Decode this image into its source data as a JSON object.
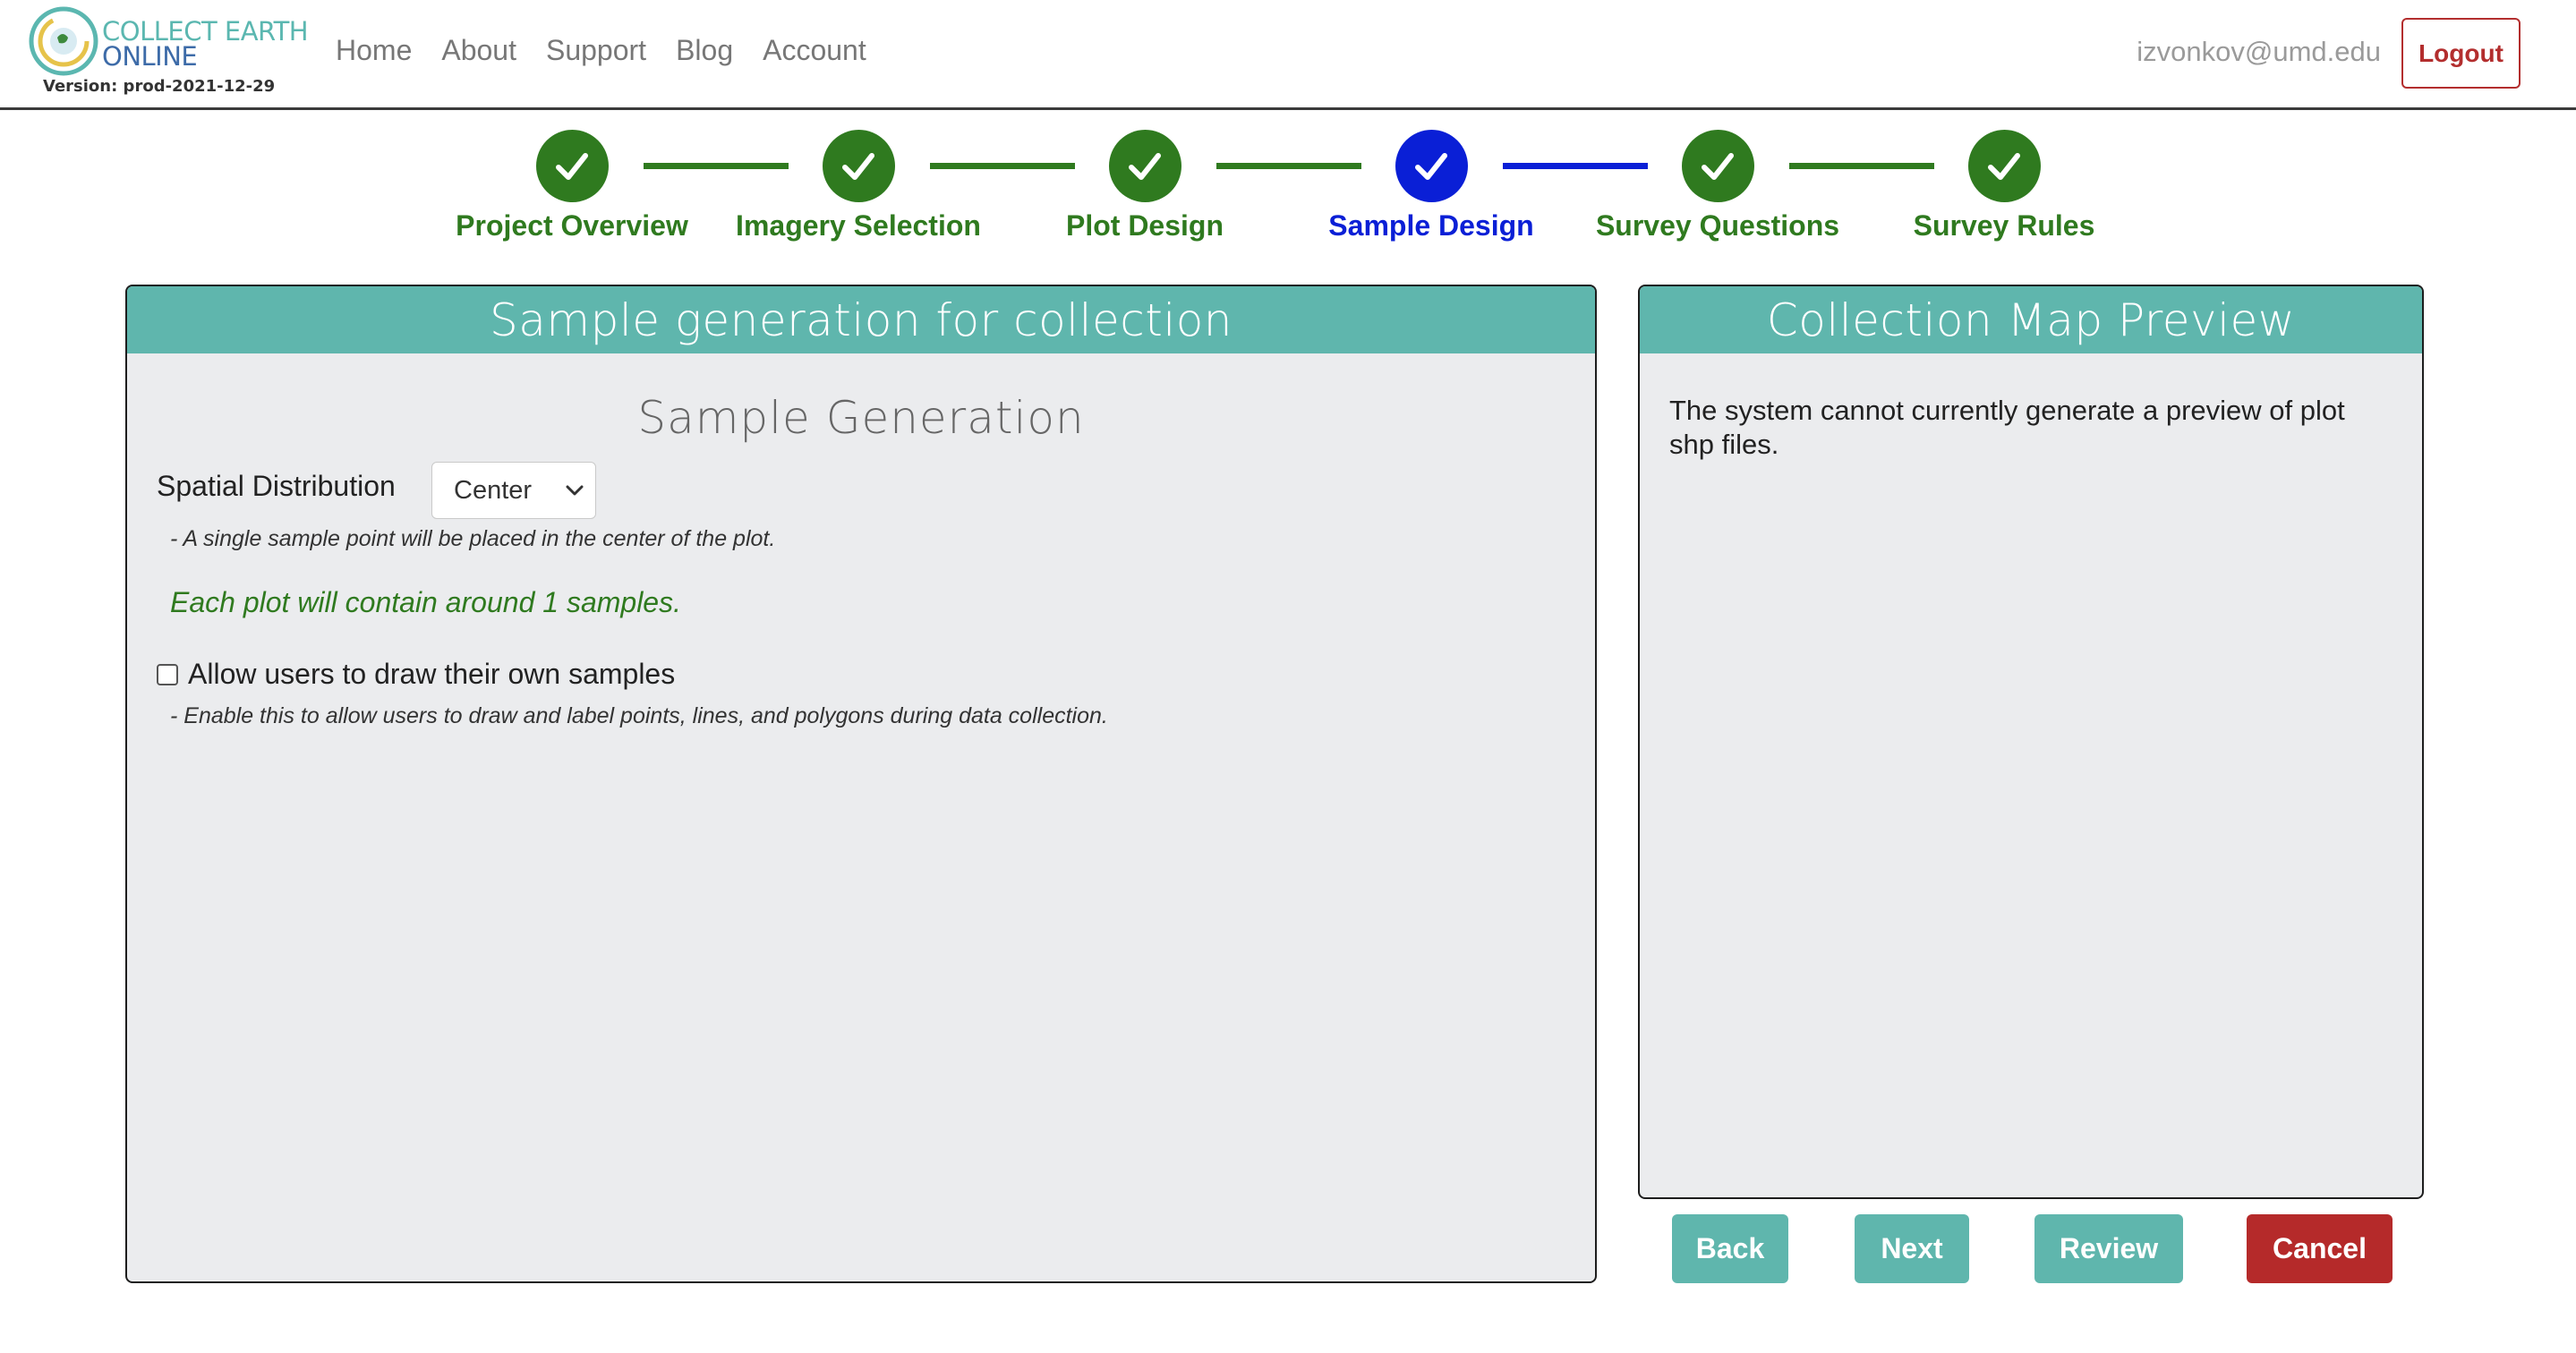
{
  "brand": {
    "line1": "COLLECT EARTH",
    "line2": "ONLINE",
    "version": "Version: prod-2021-12-29"
  },
  "nav": {
    "links": [
      "Home",
      "About",
      "Support",
      "Blog",
      "Account"
    ],
    "user_email": "izvonkov@umd.edu",
    "logout_label": "Logout"
  },
  "steps": [
    {
      "label": "Project Overview",
      "state": "complete",
      "color": "#2f7a1f"
    },
    {
      "label": "Imagery Selection",
      "state": "complete",
      "color": "#2f7a1f"
    },
    {
      "label": "Plot Design",
      "state": "complete",
      "color": "#2f7a1f"
    },
    {
      "label": "Sample Design",
      "state": "current",
      "color": "#0a1fd6"
    },
    {
      "label": "Survey Questions",
      "state": "complete",
      "color": "#2f7a1f"
    },
    {
      "label": "Survey Rules",
      "state": "complete",
      "color": "#2f7a1f"
    }
  ],
  "left_panel": {
    "header": "Sample generation for collection",
    "section_title": "Sample Generation",
    "spatial_distribution_label": "Spatial Distribution",
    "spatial_distribution_value": "Center",
    "spatial_distribution_help": "- A single sample point will be placed in the center of the plot.",
    "samples_note": "Each plot will contain around 1 samples.",
    "allow_draw_label": "Allow users to draw their own samples",
    "allow_draw_checked": false,
    "allow_draw_help": "- Enable this to allow users to draw and label points, lines, and polygons during data collection."
  },
  "right_panel": {
    "header": "Collection Map Preview",
    "message": "The system cannot currently generate a preview of plot shp files."
  },
  "actions": {
    "back": "Back",
    "next": "Next",
    "review": "Review",
    "cancel": "Cancel"
  },
  "colors": {
    "accent_teal": "#5fb6ad",
    "complete_green": "#2f7a1f",
    "current_blue": "#0a1fd6",
    "danger_red": "#b52a2a"
  }
}
